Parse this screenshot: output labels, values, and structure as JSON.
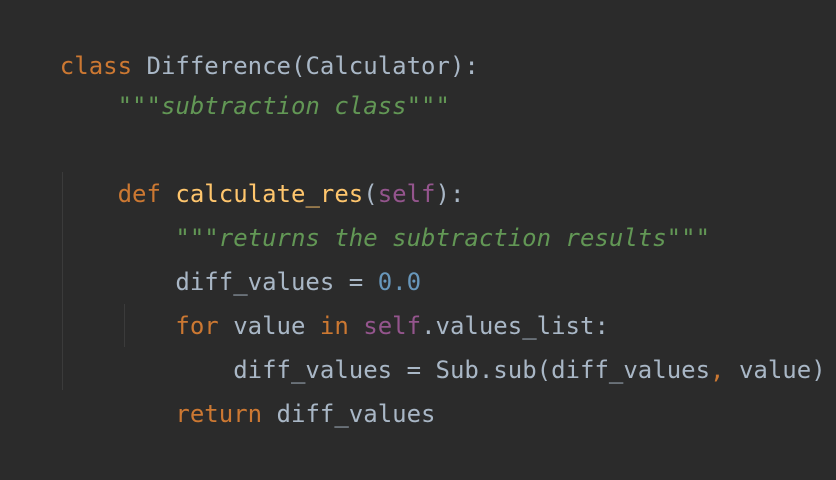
{
  "editor": {
    "colors": {
      "background": "#2b2b2b",
      "keyword": "#cc7832",
      "function": "#ffc66d",
      "text": "#a9b7c6",
      "docstring": "#629755",
      "number": "#6897bb",
      "self": "#94558d"
    },
    "lines": [
      {
        "kw_class": "class",
        "space": " ",
        "name": "Difference",
        "open": "(",
        "base": "Calculator",
        "close": "):"
      },
      {
        "indent": "    ",
        "doc": "\"\"\"subtraction class\"\"\""
      },
      {},
      {
        "indent": "    ",
        "kw_def": "def",
        "space": " ",
        "fn": "calculate_res",
        "open": "(",
        "self": "self",
        "close": "):"
      },
      {
        "indent": "        ",
        "doc": "\"\"\"returns the subtraction results\"\"\""
      },
      {
        "indent": "        ",
        "var": "diff_values",
        "eq": " = ",
        "num": "0.0"
      },
      {
        "indent": "        ",
        "kw_for": "for",
        "sp1": " ",
        "var": "value",
        "sp2": " ",
        "kw_in": "in",
        "sp3": " ",
        "self": "self",
        "attr": ".values_list:"
      },
      {
        "indent": "            ",
        "var": "diff_values",
        "eq": " = ",
        "call": "Sub.sub(diff_values",
        "comma": ",",
        "rest": " value)"
      },
      {
        "indent": "        ",
        "kw_return": "return",
        "space": " ",
        "var": "diff_values"
      }
    ]
  }
}
